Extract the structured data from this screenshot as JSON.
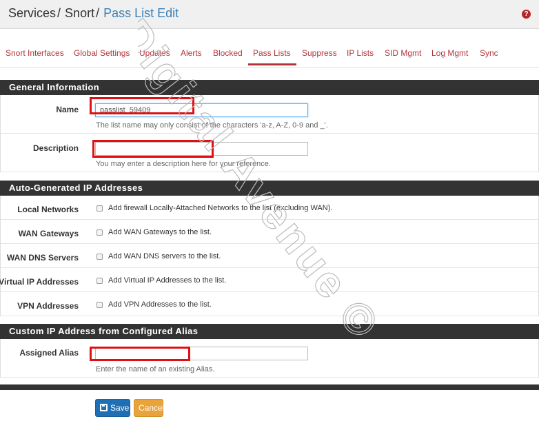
{
  "breadcrumb": {
    "items": [
      "Services",
      "Snort"
    ],
    "separator": "/",
    "current": "Pass List Edit"
  },
  "help_icon": {
    "glyph": "?",
    "name": "help-icon"
  },
  "tabs": [
    {
      "label": "Snort Interfaces"
    },
    {
      "label": "Global Settings"
    },
    {
      "label": "Updates"
    },
    {
      "label": "Alerts"
    },
    {
      "label": "Blocked"
    },
    {
      "label": "Pass Lists",
      "active": true
    },
    {
      "label": "Suppress"
    },
    {
      "label": "IP Lists"
    },
    {
      "label": "SID Mgmt"
    },
    {
      "label": "Log Mgmt"
    },
    {
      "label": "Sync"
    }
  ],
  "general": {
    "title": "General Information",
    "name_label": "Name",
    "name_value": "passlist_59409",
    "name_help": "The list name may only consist of the characters 'a-z, A-Z, 0-9 and _'.",
    "desc_label": "Description",
    "desc_value": "",
    "desc_help": "You may enter a description here for your reference."
  },
  "auto": {
    "title": "Auto-Generated IP Addresses",
    "rows": [
      {
        "label": "Local Networks",
        "text": "Add firewall Locally-Attached Networks to the list (excluding WAN).",
        "checked": false
      },
      {
        "label": "WAN Gateways",
        "text": "Add WAN Gateways to the list.",
        "checked": false
      },
      {
        "label": "WAN DNS Servers",
        "text": "Add WAN DNS servers to the list.",
        "checked": false
      },
      {
        "label": "Virtual IP Addresses",
        "text": "Add Virtual IP Addresses to the list.",
        "checked": false
      },
      {
        "label": "VPN Addresses",
        "text": "Add VPN Addresses to the list.",
        "checked": false
      }
    ]
  },
  "alias": {
    "title": "Custom IP Address from Configured Alias",
    "label": "Assigned Alias",
    "value": "",
    "help": "Enter the name of an existing Alias."
  },
  "buttons": {
    "save": "Save",
    "cancel": "Cancel"
  },
  "watermark": {
    "text": "Digital Avenue ©"
  },
  "colors": {
    "accent": "#3b80b5",
    "tab_text": "#b3343a",
    "section_bg": "#333333",
    "highlight": "#e01010",
    "save_bg": "#1f6fb5",
    "cancel_bg": "#e8a33b"
  }
}
